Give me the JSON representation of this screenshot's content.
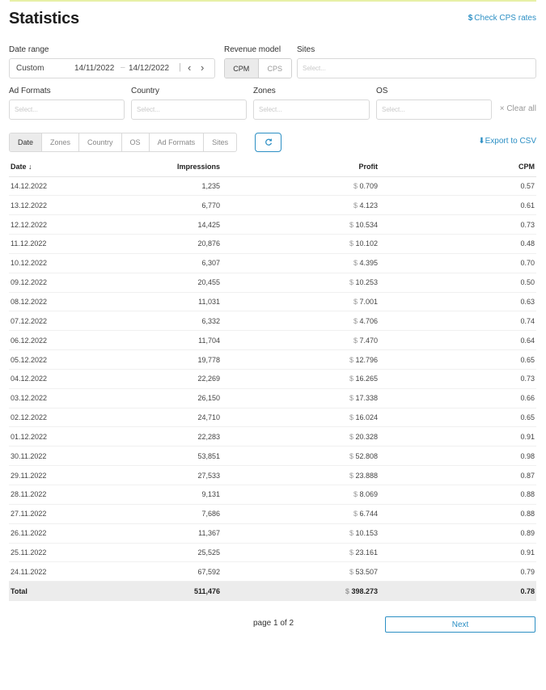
{
  "page": {
    "title": "Statistics",
    "check_cps_rates": "Check CPS rates"
  },
  "filters": {
    "date_range": {
      "label": "Date range",
      "preset": "Custom",
      "from": "14/11/2022",
      "to": "14/12/2022"
    },
    "revenue_model": {
      "label": "Revenue model",
      "options": [
        "CPM",
        "CPS"
      ],
      "selected": "CPM"
    },
    "sites": {
      "label": "Sites",
      "placeholder": "Select..."
    },
    "ad_formats": {
      "label": "Ad Formats",
      "placeholder": "Select..."
    },
    "country": {
      "label": "Country",
      "placeholder": "Select..."
    },
    "zones": {
      "label": "Zones",
      "placeholder": "Select..."
    },
    "os": {
      "label": "OS",
      "placeholder": "Select..."
    },
    "clear_all": "Clear all"
  },
  "tabs": [
    "Date",
    "Zones",
    "Country",
    "OS",
    "Ad Formats",
    "Sites"
  ],
  "active_tab": "Date",
  "export_label": "Export to CSV",
  "colors": {
    "accent": "#2c8fc4",
    "tab_active_bg": "#ebebeb",
    "total_bg": "#ececec"
  },
  "table": {
    "columns": [
      "Date",
      "Impressions",
      "Profit",
      "CPM"
    ],
    "currency": "$",
    "rows": [
      [
        "14.12.2022",
        "1,235",
        "0.709",
        "0.57"
      ],
      [
        "13.12.2022",
        "6,770",
        "4.123",
        "0.61"
      ],
      [
        "12.12.2022",
        "14,425",
        "10.534",
        "0.73"
      ],
      [
        "11.12.2022",
        "20,876",
        "10.102",
        "0.48"
      ],
      [
        "10.12.2022",
        "6,307",
        "4.395",
        "0.70"
      ],
      [
        "09.12.2022",
        "20,455",
        "10.253",
        "0.50"
      ],
      [
        "08.12.2022",
        "11,031",
        "7.001",
        "0.63"
      ],
      [
        "07.12.2022",
        "6,332",
        "4.706",
        "0.74"
      ],
      [
        "06.12.2022",
        "11,704",
        "7.470",
        "0.64"
      ],
      [
        "05.12.2022",
        "19,778",
        "12.796",
        "0.65"
      ],
      [
        "04.12.2022",
        "22,269",
        "16.265",
        "0.73"
      ],
      [
        "03.12.2022",
        "26,150",
        "17.338",
        "0.66"
      ],
      [
        "02.12.2022",
        "24,710",
        "16.024",
        "0.65"
      ],
      [
        "01.12.2022",
        "22,283",
        "20.328",
        "0.91"
      ],
      [
        "30.11.2022",
        "53,851",
        "52.808",
        "0.98"
      ],
      [
        "29.11.2022",
        "27,533",
        "23.888",
        "0.87"
      ],
      [
        "28.11.2022",
        "9,131",
        "8.069",
        "0.88"
      ],
      [
        "27.11.2022",
        "7,686",
        "6.744",
        "0.88"
      ],
      [
        "26.11.2022",
        "11,367",
        "10.153",
        "0.89"
      ],
      [
        "25.11.2022",
        "25,525",
        "23.161",
        "0.91"
      ],
      [
        "24.11.2022",
        "67,592",
        "53.507",
        "0.79"
      ]
    ],
    "total": [
      "Total",
      "511,476",
      "398.273",
      "0.78"
    ]
  },
  "pagination": {
    "text": "page 1 of 2",
    "next_label": "Next"
  }
}
